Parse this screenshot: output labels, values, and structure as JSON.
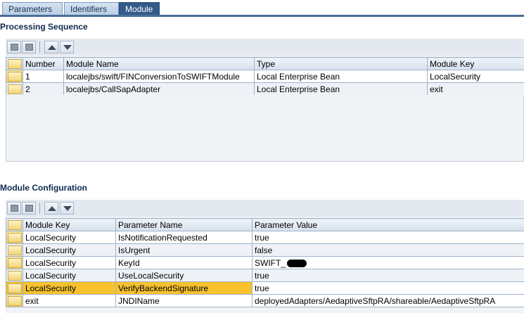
{
  "tabs": [
    {
      "label": "Parameters",
      "active": false
    },
    {
      "label": "Identifiers",
      "active": false
    },
    {
      "label": "Module",
      "active": true
    }
  ],
  "processing": {
    "title": "Processing Sequence",
    "columns": [
      "Number",
      "Module Name",
      "Type",
      "Module Key"
    ],
    "rows": [
      {
        "number": "1",
        "module_name": "localejbs/swift/FINConversionToSWIFTModule",
        "type": "Local Enterprise Bean",
        "module_key": "LocalSecurity"
      },
      {
        "number": "2",
        "module_name": "localejbs/CallSapAdapter",
        "type": "Local Enterprise Bean",
        "module_key": "exit"
      }
    ]
  },
  "configuration": {
    "title": "Module Configuration",
    "columns": [
      "Module Key",
      "Parameter Name",
      "Parameter Value"
    ],
    "rows": [
      {
        "module_key": "LocalSecurity",
        "param": "IsNotificationRequested",
        "value": "true"
      },
      {
        "module_key": "LocalSecurity",
        "param": "IsUrgent",
        "value": "false"
      },
      {
        "module_key": "LocalSecurity",
        "param": "KeyId",
        "value": "SWIFT_"
      },
      {
        "module_key": "LocalSecurity",
        "param": "UseLocalSecurity",
        "value": "true"
      },
      {
        "module_key": "LocalSecurity",
        "param": "VerifyBackendSignature",
        "value": "true"
      },
      {
        "module_key": "exit",
        "param": "JNDIName",
        "value": "deployedAdapters/AedaptiveSftpRA/shareable/AedaptiveSftpRA"
      }
    ]
  },
  "toolbar_icons": [
    "insert-row-icon",
    "delete-row-icon",
    "move-up-icon",
    "move-down-icon"
  ],
  "colors": {
    "accent": "#335b8a",
    "highlight_row": "#f7c22e"
  }
}
